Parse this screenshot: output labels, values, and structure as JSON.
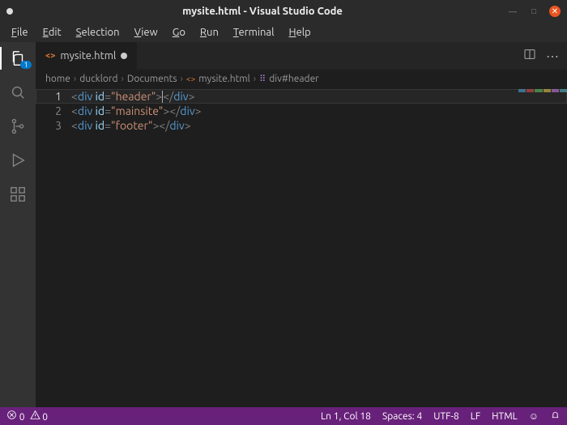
{
  "window": {
    "title": "mysite.html - Visual Studio Code",
    "modified": true
  },
  "menu": [
    "File",
    "Edit",
    "Selection",
    "View",
    "Go",
    "Run",
    "Terminal",
    "Help"
  ],
  "activity": {
    "explorer_badge": "1"
  },
  "tab": {
    "filename": "mysite.html",
    "icon": "<>"
  },
  "breadcrumb": {
    "parts": [
      "home",
      "ducklord",
      "Documents"
    ],
    "file": "mysite.html",
    "symbol": "div#header"
  },
  "editor": {
    "line_numbers": [
      "1",
      "2",
      "3"
    ],
    "lines": [
      {
        "tag": "div",
        "attr": "id",
        "val": "header"
      },
      {
        "tag": "div",
        "attr": "id",
        "val": "mainsite"
      },
      {
        "tag": "div",
        "attr": "id",
        "val": "footer"
      }
    ]
  },
  "status": {
    "errors": "0",
    "warnings": "0",
    "pos": "Ln 1, Col 18",
    "spaces": "Spaces: 4",
    "enc": "UTF-8",
    "eol": "LF",
    "lang": "HTML",
    "feedback": "☺"
  },
  "minimap_colors": [
    "#4ea1d3",
    "#d94f4f",
    "#5fbf5f",
    "#e0c04c",
    "#c678dd",
    "#56b6c2"
  ]
}
